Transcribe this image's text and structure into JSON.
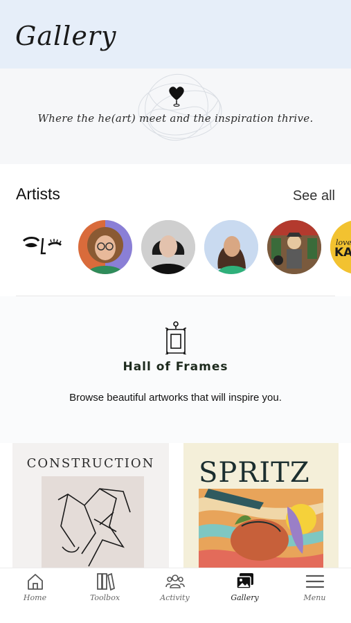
{
  "header": {
    "title": "Gallery"
  },
  "banner": {
    "tagline": "Where the he(art) meet and the inspiration thrive."
  },
  "artists": {
    "title": "Artists",
    "see_all_label": "See all",
    "items": [
      {
        "icon": "face-line-art"
      },
      {
        "icon": "person-curly-hair-glasses"
      },
      {
        "icon": "person-dark-hair"
      },
      {
        "icon": "person-long-hair-green-top"
      },
      {
        "icon": "illustrated-character"
      },
      {
        "icon": "yellow-logo"
      }
    ],
    "partial_avatar_text": {
      "line1": "love",
      "line2": "KA"
    }
  },
  "hall": {
    "title": "Hall of Frames",
    "subtitle": "Browse beautiful artworks that will inspire you."
  },
  "artworks": [
    {
      "title": "CONSTRUCTION"
    },
    {
      "title": "SPRITZ"
    }
  ],
  "nav": {
    "items": [
      {
        "label": "Home",
        "icon": "home-icon"
      },
      {
        "label": "Toolbox",
        "icon": "toolbox-icon"
      },
      {
        "label": "Activity",
        "icon": "people-icon"
      },
      {
        "label": "Gallery",
        "icon": "gallery-icon",
        "active": true
      },
      {
        "label": "Menu",
        "icon": "menu-icon"
      }
    ]
  },
  "colors": {
    "header_bg": "#e6eef9",
    "banner_bg": "#f6f7f9",
    "accent_yellow": "#f2c230"
  }
}
